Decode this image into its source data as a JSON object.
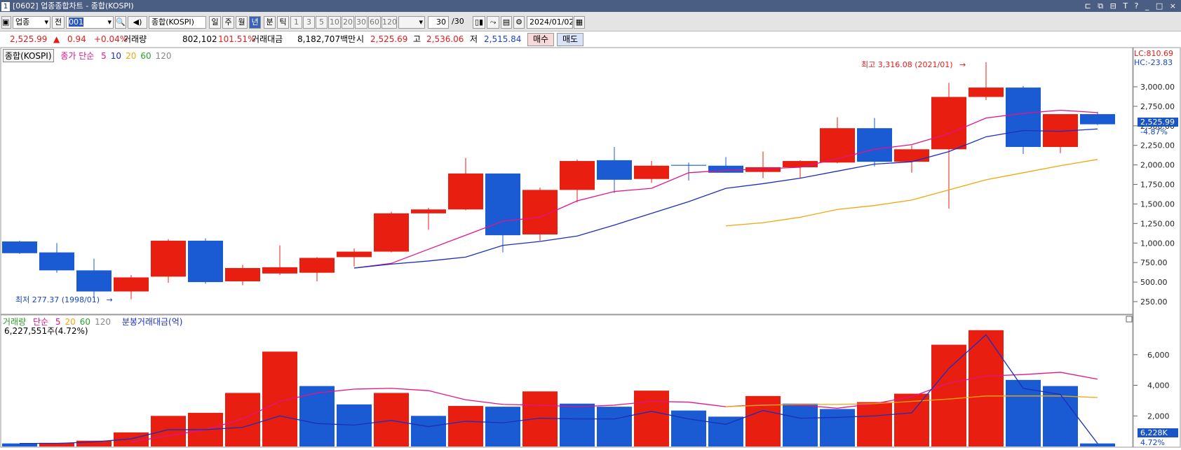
{
  "window": {
    "app_number": "1",
    "title": "[0602] 업종종합차트 - 종합(KOSPI)",
    "controls": "⊏ ⧉ ⊟ T ? _ □ ×"
  },
  "toolbar": {
    "market_select": "업종",
    "prev_button": "전",
    "code_value": "001",
    "search_icon_glyph": "🔍",
    "speaker_glyph": "◀)",
    "index_name": "종합(KOSPI)",
    "period_tabs": [
      "일",
      "주",
      "월",
      "년",
      "분",
      "틱"
    ],
    "active_tab": "년",
    "interval_buttons": [
      "1",
      "3",
      "5",
      "10",
      "20",
      "30",
      "60",
      "120"
    ],
    "count_value": "30",
    "count_total": "/30",
    "date_value": "2024/01/02"
  },
  "quote": {
    "price": "2,525.99",
    "arrow": "▲",
    "change": "0.94",
    "change_pct": "+0.04%",
    "volume_label": "거래량",
    "volume": "802,102",
    "volume_pct": "101.51%",
    "amount_label": "거래대금",
    "amount": "8,182,707백만",
    "open_label": "시",
    "open": "2,525.69",
    "high_label": "고",
    "high": "2,536.06",
    "low_label": "저",
    "low": "2,515.84",
    "buy_button": "매수",
    "sell_button": "매도"
  },
  "price_panel": {
    "name_box": "종합(KOSPI)",
    "ma_label": "종가 단순",
    "ma_periods": [
      "5",
      "10",
      "20",
      "60",
      "120"
    ],
    "ma_colors": [
      "#e3138a",
      "#1b2fbd",
      "#f2a60c",
      "#2aa02a",
      "#888888"
    ],
    "high_note": "최고 3,316.08 (2021/01)",
    "low_note": "최저 277.37 (1998/01)",
    "lc": "LC:810.69",
    "hc": "HC:-23.83",
    "current_tag": "2,525.99",
    "current_pct": "-4.87%"
  },
  "volume_panel": {
    "label_volume": "거래량",
    "ma_label": "단순",
    "ma_periods": [
      "5",
      "20",
      "60",
      "120"
    ],
    "amount_label": "분봉거래대금(억)",
    "volume_value": "6,227,551주(4.72%)",
    "last_tag": "6,228K",
    "last_pct": "4.72%"
  },
  "chart_data": {
    "type": "candlestick",
    "price_axis": {
      "ticks": [
        250,
        500,
        750,
        1000,
        1250,
        1500,
        1750,
        2000,
        2250,
        2500,
        2750,
        3000
      ],
      "tick_labels": [
        "250.00",
        "500.00",
        "750.00",
        "1,000.00",
        "1,250.00",
        "1,500.00",
        "1,750.00",
        "2,000.00",
        "2,250.00",
        "2,500.00",
        "2,750.00",
        "3,000.00"
      ]
    },
    "volume_axis": {
      "ticks": [
        2000,
        4000,
        6000
      ],
      "tick_labels": [
        "2,000",
        "4,000",
        "6,000"
      ]
    },
    "candles": [
      {
        "o": 1020,
        "h": 1030,
        "l": 860,
        "c": 870
      },
      {
        "o": 880,
        "h": 1000,
        "l": 620,
        "c": 650
      },
      {
        "o": 650,
        "h": 800,
        "l": 300,
        "c": 380
      },
      {
        "o": 380,
        "h": 590,
        "l": 280,
        "c": 560
      },
      {
        "o": 570,
        "h": 1050,
        "l": 490,
        "c": 1030
      },
      {
        "o": 1030,
        "h": 1060,
        "l": 480,
        "c": 500
      },
      {
        "o": 510,
        "h": 720,
        "l": 460,
        "c": 680
      },
      {
        "o": 690,
        "h": 970,
        "l": 590,
        "c": 610
      },
      {
        "o": 620,
        "h": 820,
        "l": 510,
        "c": 810
      },
      {
        "o": 820,
        "h": 930,
        "l": 700,
        "c": 890
      },
      {
        "o": 890,
        "h": 1400,
        "l": 880,
        "c": 1380
      },
      {
        "o": 1380,
        "h": 1450,
        "l": 1170,
        "c": 1430
      },
      {
        "o": 1430,
        "h": 2090,
        "l": 1420,
        "c": 1890
      },
      {
        "o": 1890,
        "h": 1890,
        "l": 880,
        "c": 1100
      },
      {
        "o": 1110,
        "h": 1710,
        "l": 1030,
        "c": 1680
      },
      {
        "o": 1680,
        "h": 2070,
        "l": 1520,
        "c": 2050
      },
      {
        "o": 2060,
        "h": 2230,
        "l": 1640,
        "c": 1810
      },
      {
        "o": 1820,
        "h": 2050,
        "l": 1770,
        "c": 1990
      },
      {
        "o": 2000,
        "h": 2030,
        "l": 1800,
        "c": 1990
      },
      {
        "o": 1990,
        "h": 2100,
        "l": 1900,
        "c": 1900
      },
      {
        "o": 1910,
        "h": 2170,
        "l": 1830,
        "c": 1970
      },
      {
        "o": 1970,
        "h": 2060,
        "l": 1830,
        "c": 2050
      },
      {
        "o": 2030,
        "h": 2610,
        "l": 2020,
        "c": 2470
      },
      {
        "o": 2470,
        "h": 2600,
        "l": 1980,
        "c": 2040
      },
      {
        "o": 2040,
        "h": 2250,
        "l": 1900,
        "c": 2200
      },
      {
        "o": 2200,
        "h": 3050,
        "l": 1440,
        "c": 2870
      },
      {
        "o": 2870,
        "h": 3316,
        "l": 2830,
        "c": 2990
      },
      {
        "o": 2990,
        "h": 3010,
        "l": 2140,
        "c": 2230
      },
      {
        "o": 2230,
        "h": 2650,
        "l": 2150,
        "c": 2650
      },
      {
        "o": 2520,
        "h": 2680,
        "l": 2510,
        "c": 2650
      }
    ],
    "candle_colors": [
      "blue",
      "blue",
      "blue",
      "red",
      "red",
      "blue",
      "red",
      "red",
      "red",
      "red",
      "red",
      "red",
      "red",
      "blue",
      "red",
      "red",
      "blue",
      "red",
      "blue",
      "blue",
      "red",
      "red",
      "red",
      "blue",
      "red",
      "red",
      "red",
      "blue",
      "red",
      "blue"
    ],
    "ma5": [
      null,
      null,
      null,
      null,
      null,
      null,
      null,
      null,
      null,
      680,
      740,
      920,
      1100,
      1280,
      1330,
      1540,
      1660,
      1700,
      1900,
      1930,
      1950,
      1970,
      2080,
      2200,
      2260,
      2400,
      2600,
      2660,
      2700,
      2670
    ],
    "ma10": [
      null,
      null,
      null,
      null,
      null,
      null,
      null,
      null,
      null,
      680,
      730,
      770,
      820,
      970,
      1020,
      1090,
      1230,
      1380,
      1530,
      1700,
      1760,
      1830,
      1920,
      2010,
      2040,
      2170,
      2360,
      2440,
      2430,
      2460
    ],
    "ma20": [
      null,
      null,
      null,
      null,
      null,
      null,
      null,
      null,
      null,
      null,
      null,
      null,
      null,
      null,
      null,
      null,
      null,
      null,
      null,
      1220,
      1260,
      1330,
      1430,
      1480,
      1550,
      1680,
      1810,
      1900,
      1990,
      2070
    ],
    "volumes": [
      200,
      240,
      380,
      920,
      2000,
      2200,
      3500,
      6200,
      3950,
      2750,
      3500,
      2000,
      2650,
      2600,
      3600,
      2800,
      2600,
      3650,
      2350,
      1950,
      3300,
      2800,
      2450,
      2900,
      3450,
      6650,
      7600,
      4350,
      3950,
      200
    ],
    "volume_colors": [
      "blue",
      "red",
      "red",
      "red",
      "red",
      "red",
      "red",
      "red",
      "blue",
      "blue",
      "red",
      "blue",
      "red",
      "blue",
      "red",
      "blue",
      "blue",
      "red",
      "blue",
      "blue",
      "red",
      "blue",
      "blue",
      "red",
      "red",
      "red",
      "red",
      "blue",
      "blue",
      "blue"
    ],
    "vol_ma5": [
      null,
      null,
      null,
      300,
      700,
      1100,
      1800,
      2950,
      3500,
      3750,
      3800,
      3650,
      3050,
      2750,
      2700,
      2600,
      2700,
      2950,
      2900,
      2600,
      2750,
      2700,
      2500,
      2800,
      3250,
      4150,
      4600,
      4700,
      4850,
      4400
    ],
    "vol_ma20": [
      null,
      null,
      null,
      null,
      null,
      null,
      null,
      null,
      null,
      null,
      null,
      null,
      null,
      null,
      null,
      null,
      null,
      null,
      null,
      2600,
      2700,
      2750,
      2750,
      2800,
      2950,
      3100,
      3300,
      3300,
      3300,
      3200
    ],
    "amount": [
      200,
      200,
      300,
      500,
      1100,
      1100,
      1250,
      2000,
      1500,
      1400,
      1700,
      1300,
      1650,
      1550,
      1850,
      1800,
      1800,
      2300,
      1800,
      1450,
      2350,
      1850,
      1900,
      2000,
      2200,
      5100,
      7300,
      3800,
      3400,
      200
    ]
  }
}
